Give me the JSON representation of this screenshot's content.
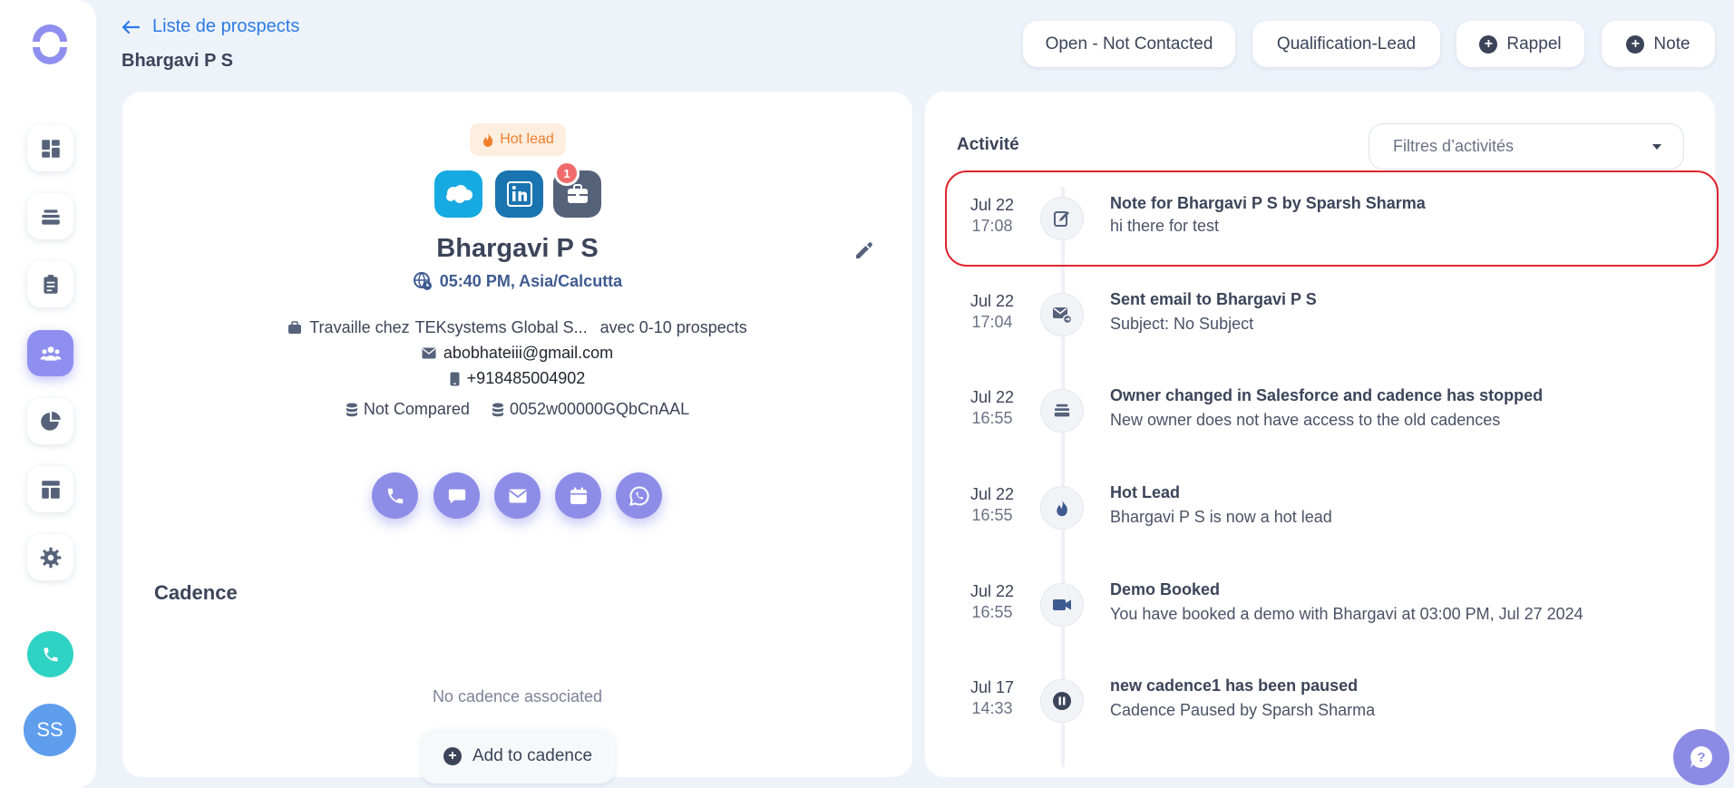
{
  "header": {
    "back_label": "Liste de prospects",
    "prospect_name": "Bhargavi P S",
    "buttons": {
      "status": "Open - Not Contacted",
      "qualification": "Qualification-Lead",
      "reminder": "Rappel",
      "note": "Note"
    }
  },
  "sidebar": {
    "avatar_initials": "SS",
    "items": [
      "dashboard-icon",
      "layers-icon",
      "clipboard-icon",
      "people-icon",
      "pie-chart-icon",
      "layout-icon",
      "gear-icon"
    ]
  },
  "lead": {
    "badge": "Hot lead",
    "integrations_notification_count": "1",
    "name": "Bhargavi P S",
    "timezone": "05:40 PM, Asia/Calcutta",
    "works_at_prefix": "Travaille chez",
    "company": "TEKsystems Global S...",
    "company_size": "avec 0-10 prospects",
    "email": "abobhateiii@gmail.com",
    "phone": "+918485004902",
    "compare_status": "Not Compared",
    "salesforce_id": "0052w00000GQbCnAAL"
  },
  "cadence": {
    "title": "Cadence",
    "empty_text": "No cadence associated",
    "add_label": "Add to cadence"
  },
  "activity": {
    "title": "Activité",
    "filter_placeholder": "Filtres d’activités",
    "items": [
      {
        "date": "Jul 22",
        "time": "17:08",
        "title": "Note for Bhargavi P S by Sparsh Sharma",
        "subtitle": "hi there for test",
        "icon": "note-edit-icon"
      },
      {
        "date": "Jul 22",
        "time": "17:04",
        "title": "Sent email to Bhargavi P S",
        "subtitle": "Subject: No Subject",
        "icon": "mail-sent-icon"
      },
      {
        "date": "Jul 22",
        "time": "16:55",
        "title": "Owner changed in Salesforce and cadence has stopped",
        "subtitle": "New owner does not have access to the old cadences",
        "icon": "layers-icon"
      },
      {
        "date": "Jul 22",
        "time": "16:55",
        "title": "Hot Lead",
        "subtitle": "Bhargavi P S is now a hot lead",
        "icon": "flame-icon"
      },
      {
        "date": "Jul 22",
        "time": "16:55",
        "title": "Demo Booked",
        "subtitle": "You have booked a demo with Bhargavi at 03:00 PM, Jul 27 2024",
        "icon": "video-icon"
      },
      {
        "date": "Jul 17",
        "time": "14:33",
        "title": "new cadence1 has been paused",
        "subtitle": "Cadence Paused by Sparsh Sharma",
        "icon": "pause-icon"
      }
    ]
  },
  "colors": {
    "accent": "#8f8ff0",
    "link": "#2d7be5",
    "hot": "#f07f2b",
    "highlight": "#e0262f",
    "call": "#2fd3c4"
  }
}
